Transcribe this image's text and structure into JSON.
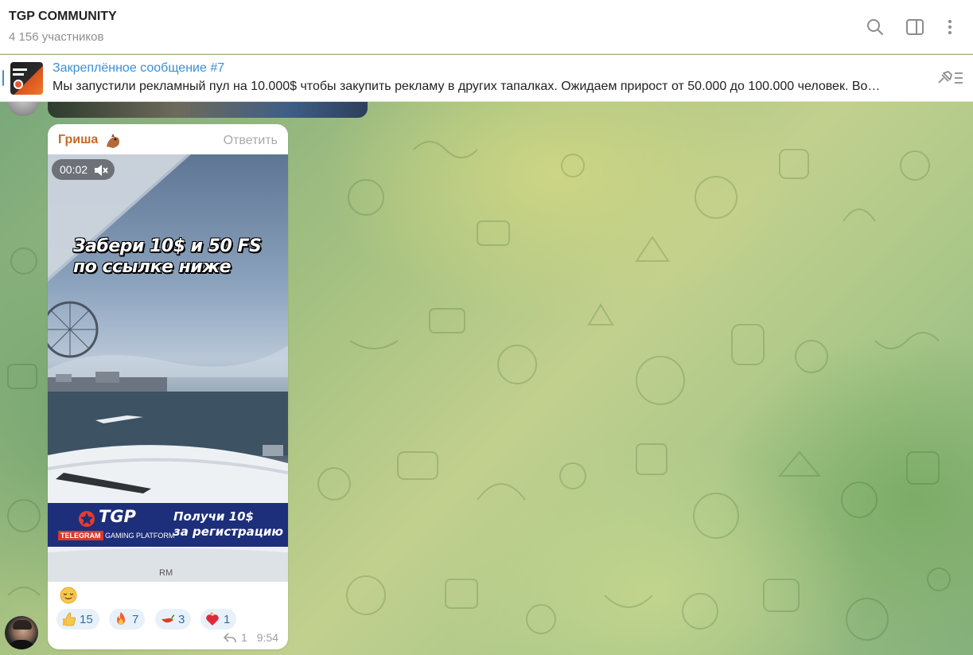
{
  "header": {
    "title": "TGP COMMUNITY",
    "subtitle": "4 156 участников",
    "icons": [
      "search-icon",
      "sidebar-toggle-icon",
      "more-vertical-icon"
    ]
  },
  "pinned": {
    "title": "Закреплённое сообщение #7",
    "text": "Мы запустили рекламный пул на 10.000$ чтобы закупить рекламу в других тапалках.  Ожидаем прирост от 50.000 до 100.000 человек.  Во…",
    "action_icon": "unpin-icon"
  },
  "message": {
    "sender": "Гриша",
    "reply_label": "Ответить",
    "video": {
      "duration": "00:02",
      "promo_line1": "Забери 10$ и 50 FS",
      "promo_line2": "по ссылке ниже",
      "banner_brand": "TGP",
      "banner_tag_red": "TELEGRAM",
      "banner_tag_rest": "GAMING PLATFORM",
      "banner_right_line1": "Получи 10$",
      "banner_right_line2": "за регистрацию",
      "watermark": "RM"
    },
    "caption_emoji": "relieved-face",
    "reactions": [
      {
        "emoji": "thumbs-up",
        "count": "15"
      },
      {
        "emoji": "fire",
        "count": "7"
      },
      {
        "emoji": "hot-pepper",
        "count": "3"
      },
      {
        "emoji": "burning-heart",
        "count": "1"
      }
    ],
    "replies": "1",
    "time": "9:54"
  },
  "colors": {
    "accent": "#3a8fd6",
    "sender": "#c46a26",
    "reaction_bg": "#e8f1f9",
    "reaction_text": "#2f6ea5",
    "banner": "#1d2f7a"
  }
}
